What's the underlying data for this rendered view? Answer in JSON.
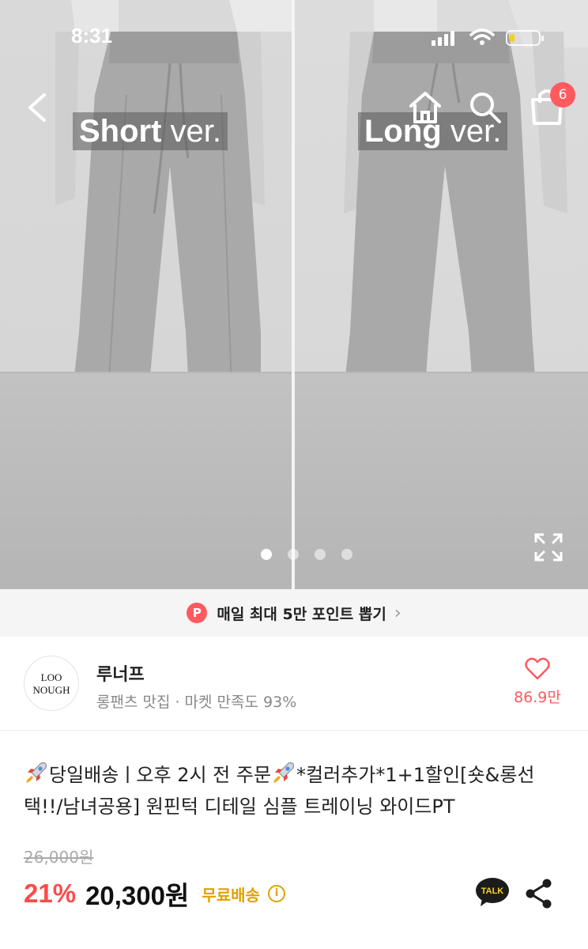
{
  "status_bar": {
    "time": "8:31"
  },
  "hero": {
    "left_label_bold": "Short",
    "left_label_thin": " ver.",
    "right_label_bold": "Long",
    "right_label_thin": " ver.",
    "cart_count": "6",
    "slide_count": 4,
    "active_slide": 1
  },
  "point_banner": {
    "badge": "P",
    "text": "매일 최대 5만 포인트 뽑기",
    "chevron": "›"
  },
  "store": {
    "logo_line1": "LOO",
    "logo_line2": "NOUGH",
    "name": "루너프",
    "meta": "롱팬츠 맛집 · 마켓 만족도 93%",
    "likes": "86.9만"
  },
  "product": {
    "title_part1": "당일배송ㅣ오후 2시 전 주문",
    "title_part2": "*컬러추가*1+1할인[숏&롱선택!!/남녀공용] 원핀턱 디테일 심플 트레이닝 와이드PT",
    "original_price": "26,000원",
    "discount": "21%",
    "price": "20,300원",
    "shipping": "무료배송",
    "info": "i",
    "talk_label": "TALK"
  },
  "colors": {
    "accent": "#ff5a5f",
    "shipping": "#e0a100",
    "discount": "#ff4a4a"
  },
  "icons": [
    "back-icon",
    "home-icon",
    "search-icon",
    "cart-icon",
    "expand-icon",
    "heart-icon",
    "rocket-icon",
    "talk-icon",
    "share-icon"
  ]
}
